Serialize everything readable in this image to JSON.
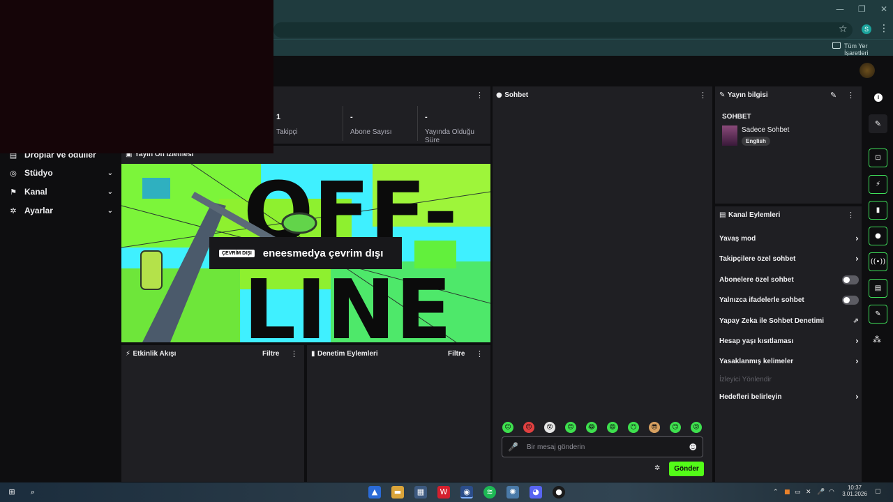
{
  "browser": {
    "bookmarks_label": "Tüm Yer İşaretleri",
    "profile_initial": "S"
  },
  "sidebar": {
    "items": [
      {
        "label": "Droplar ve ödüller",
        "icon": "gift-icon"
      },
      {
        "label": "Stüdyo",
        "icon": "studio-icon"
      },
      {
        "label": "Kanal",
        "icon": "channel-icon"
      },
      {
        "label": "Ayarlar",
        "icon": "gear-icon"
      }
    ]
  },
  "stats": [
    {
      "value": "1",
      "label": "Takipçi"
    },
    {
      "value": "-",
      "label": "Abone Sayısı"
    },
    {
      "value": "-",
      "label": "Yayında Olduğu Süre"
    }
  ],
  "preview": {
    "title": "Yayın Ön İzlemesi",
    "status_tag": "ÇEVRİM DIŞI",
    "status_text": "eneesmedya çevrim dışı",
    "art_text_1": "OFF-",
    "art_text_2": "LINE"
  },
  "activity": {
    "title": "Etkinlik Akışı",
    "filter": "Filtre"
  },
  "moderation": {
    "title": "Denetim Eylemleri",
    "filter": "Filtre"
  },
  "chat": {
    "title": "Sohbet",
    "placeholder": "Bir mesaj gönderin",
    "send_label": "Gönder",
    "emotes": [
      "😐",
      "😠",
      "😵",
      "😊",
      "😂",
      "😄",
      "😶",
      "😎",
      "😏",
      "😜"
    ]
  },
  "stream_info": {
    "title": "Yayın bilgisi",
    "category_heading": "SOHBET",
    "category_name": "Sadece Sohbet",
    "language_tag": "English"
  },
  "channel_actions": {
    "title": "Kanal Eylemleri",
    "items": [
      {
        "label": "Yavaş mod",
        "control": "chevron"
      },
      {
        "label": "Takipçilere özel sohbet",
        "control": "chevron"
      },
      {
        "label": "Abonelere özel sohbet",
        "control": "toggle-off"
      },
      {
        "label": "Yalnızca ifadelerle sohbet",
        "control": "toggle-off"
      },
      {
        "label": "Yapay Zeka ile Sohbet Denetimi",
        "control": "external"
      },
      {
        "label": "Hesap yaşı kısıtlaması",
        "control": "chevron"
      },
      {
        "label": "Yasaklanmış kelimeler",
        "control": "chevron"
      },
      {
        "label": "İzleyici Yönlendir",
        "control": "none"
      },
      {
        "label": "Hedefleri belirleyin",
        "control": "chevron"
      }
    ]
  },
  "taskbar": {
    "time": "10:37",
    "date": "3.01.2026"
  },
  "colors": {
    "accent": "#53fc18",
    "panel": "#1f1f23",
    "bg": "#0e0e10"
  }
}
